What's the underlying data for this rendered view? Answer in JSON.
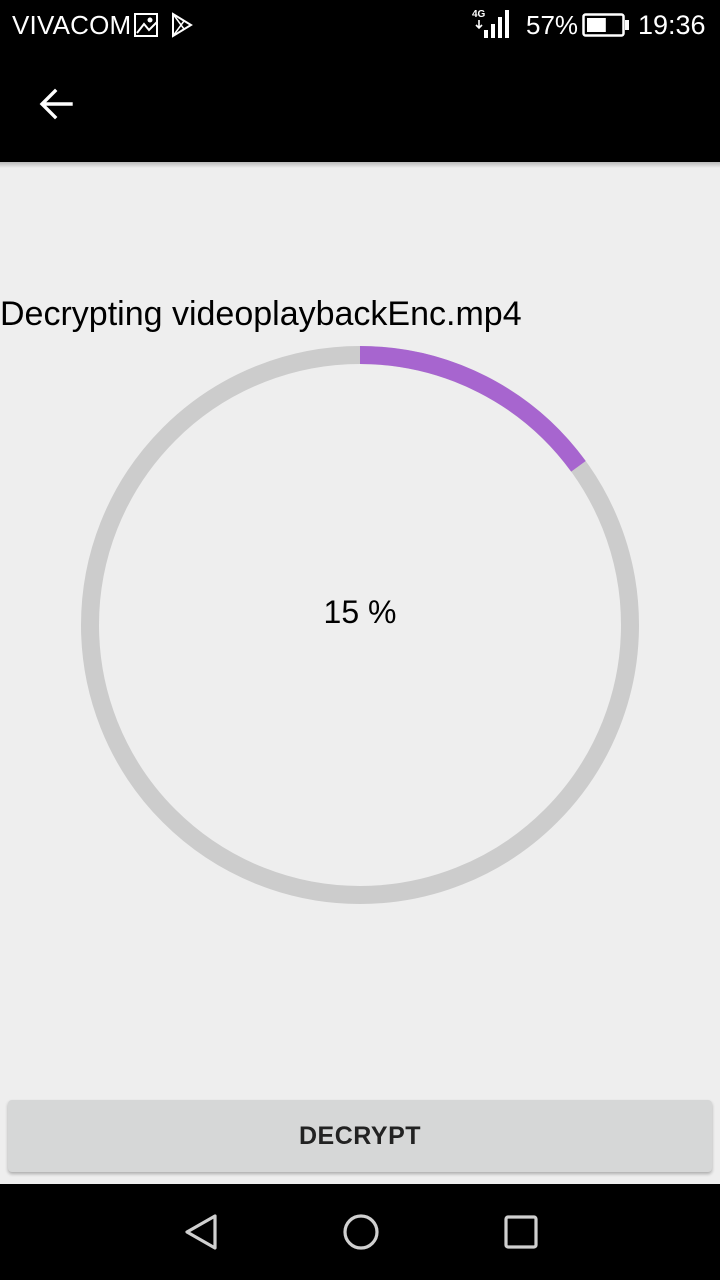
{
  "status_bar": {
    "carrier": "VIVACOM",
    "network_type": "4G",
    "battery_percent": "57%",
    "battery_level": 0.57,
    "time": "19:36",
    "icons": [
      "gallery-notification-icon",
      "play-store-notification-icon",
      "signal-icon",
      "battery-icon"
    ]
  },
  "app_bar": {
    "back_icon": "arrow-back-icon"
  },
  "main": {
    "status_text": "Decrypting videoplaybackEnc.mp4",
    "progress": {
      "percent": 15,
      "label": "15 %",
      "track_color": "#cccccc",
      "fill_color": "#a765cf"
    }
  },
  "actions": {
    "decrypt_label": "DECRYPT"
  },
  "nav_bar": {
    "icons": [
      "back-triangle-icon",
      "home-circle-icon",
      "recents-square-icon"
    ]
  }
}
